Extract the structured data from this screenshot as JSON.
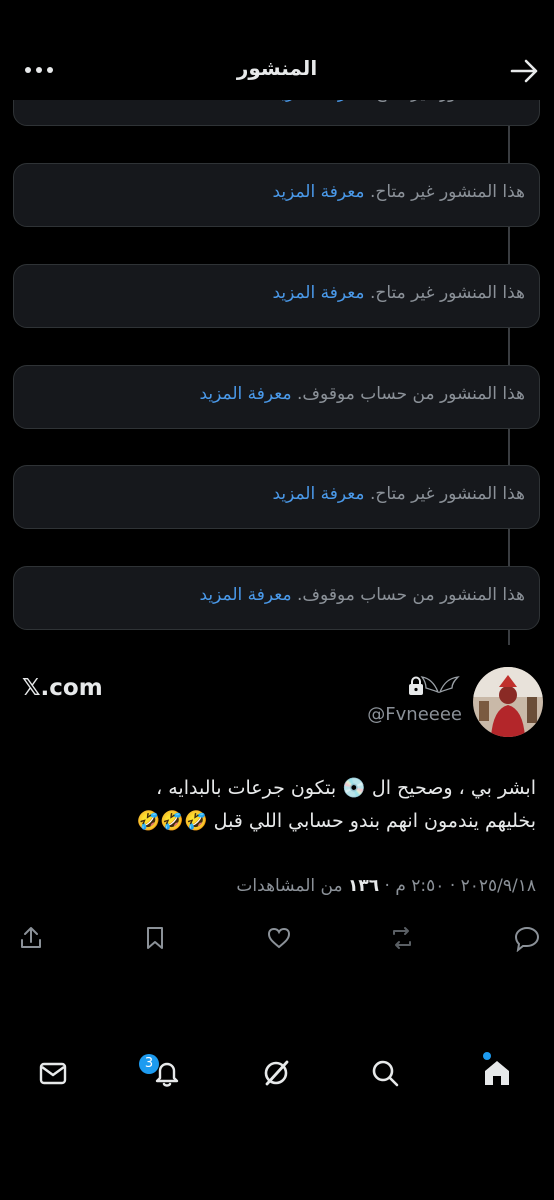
{
  "header": {
    "title": "المنشور"
  },
  "cards": {
    "unavailable_text": "هذا المنشور غير متاح.",
    "suspended_text": "هذا المنشور من حساب موقوف.",
    "learn_more": "معرفة المزيد"
  },
  "tweet": {
    "handle": "@Fvneeee",
    "source_label": "𝕏.com",
    "line1": "ابشر بي ، وصحيح ال 💿 بتكون جرعات بالبدايه ،",
    "line2": "بخليهم يندمون انهم بندو حسابي اللي قبل 🤣🤣🤣",
    "date": "٢٠٢٥/٩/١٨",
    "time": "٢:٥٠ م",
    "views_count": "١٣٦",
    "views_label": "من المشاهدات",
    "separator": "·"
  },
  "nav": {
    "notifications_badge": "3"
  },
  "colors": {
    "accent": "#1d9bf0",
    "link": "#4a99e9",
    "muted": "#8b9198",
    "card_bg": "#16181c"
  }
}
